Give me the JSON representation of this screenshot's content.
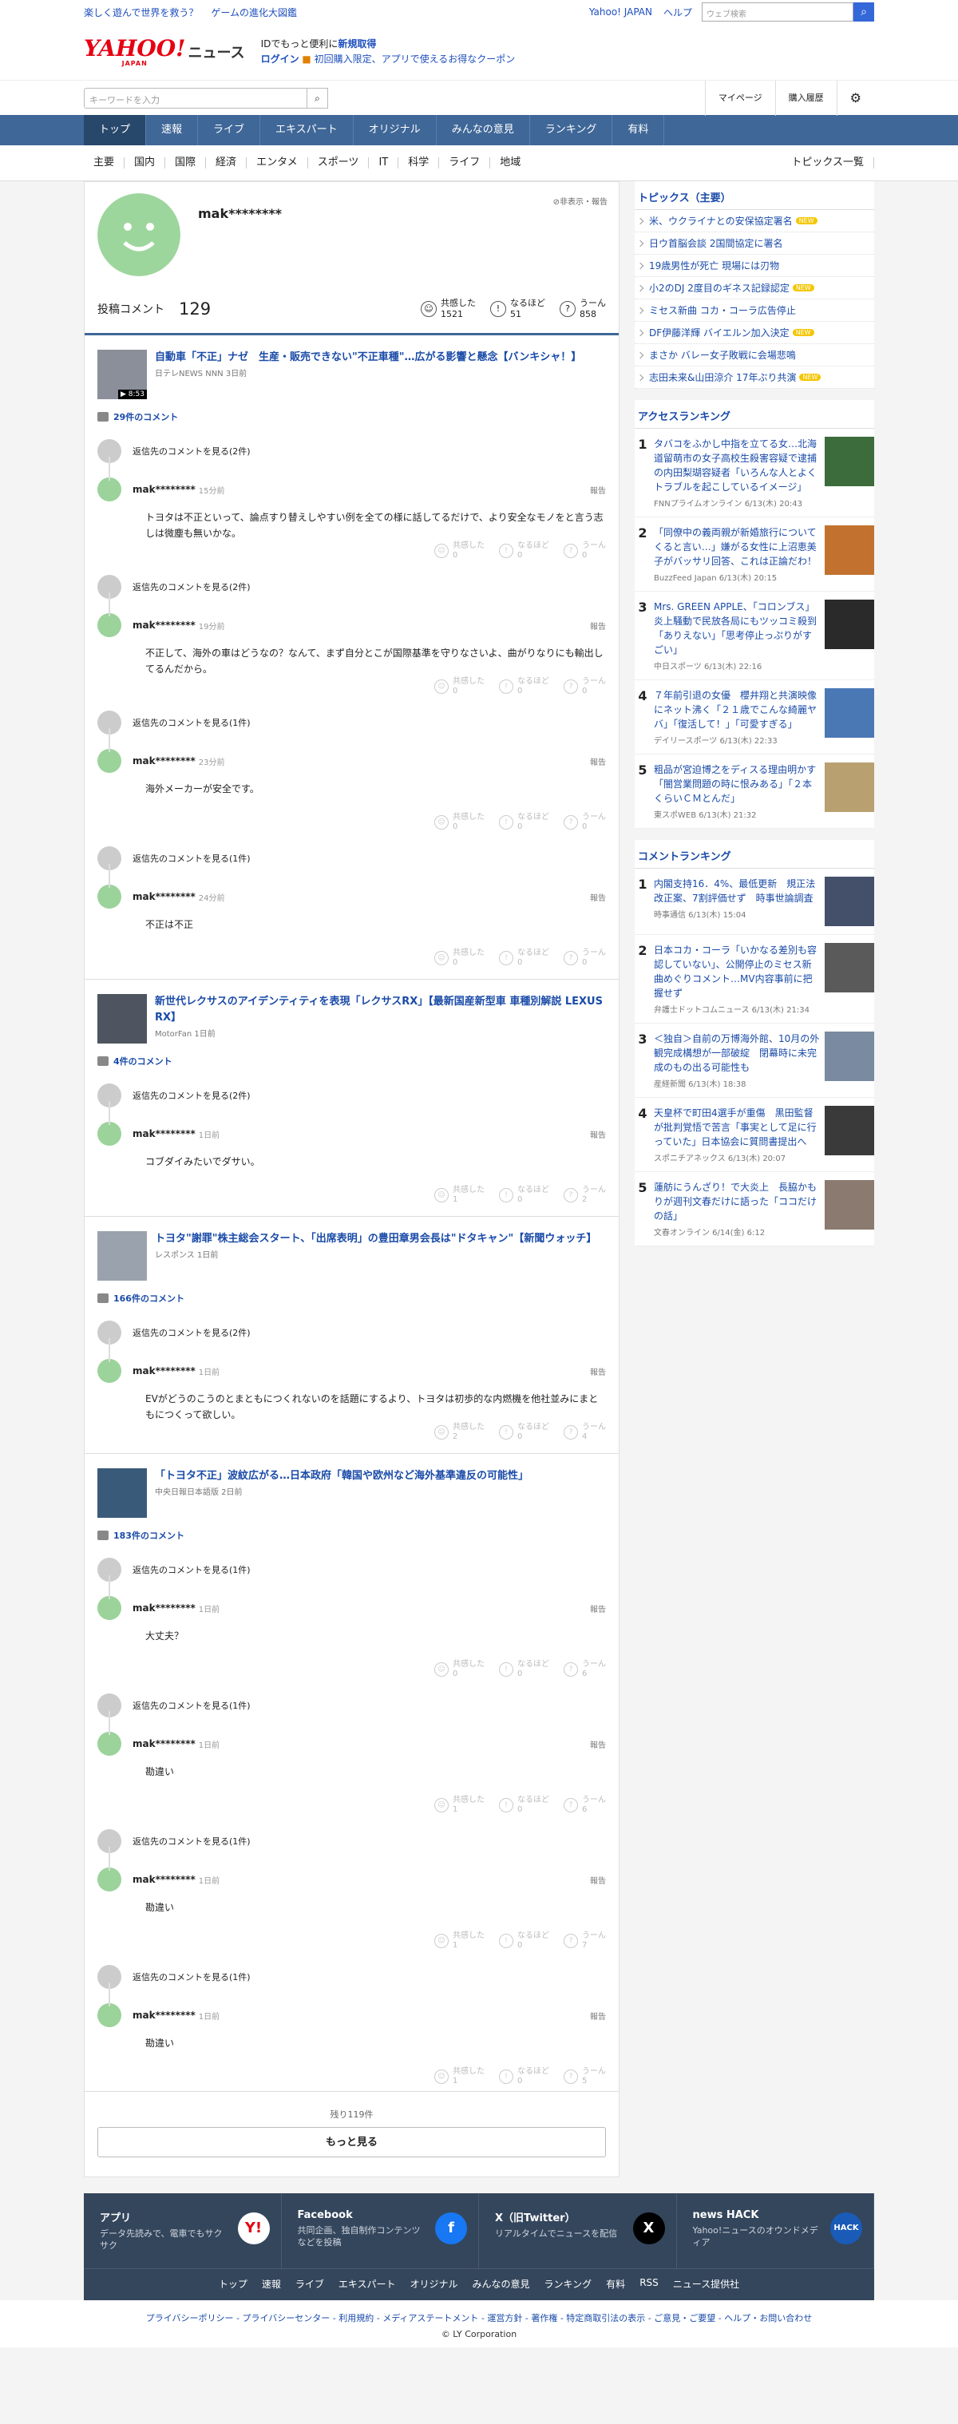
{
  "topbar": {
    "links": [
      "楽しく遊んで世界を救う？",
      "ゲームの進化大図鑑"
    ],
    "yj": "Yahoo! JAPAN",
    "help": "ヘルプ",
    "search_placeholder": "ウェブ検索"
  },
  "header": {
    "logo": "YAHOO!",
    "logo_sub": "JAPAN",
    "news": "ニュース",
    "promo1a": "IDでもっと便利に",
    "promo1b": "新規取得",
    "promo2a": "ログイン",
    "promo2b": "初回購入限定、アプリで使えるお得なクーポン"
  },
  "search": {
    "placeholder": "キーワードを入力",
    "mypage": "マイページ",
    "history": "購入履歴"
  },
  "gnav": [
    "トップ",
    "速報",
    "ライブ",
    "エキスパート",
    "オリジナル",
    "みんなの意見",
    "ランキング",
    "有料"
  ],
  "cnav": [
    "主要",
    "国内",
    "国際",
    "経済",
    "エンタメ",
    "スポーツ",
    "IT",
    "科学",
    "ライフ",
    "地域"
  ],
  "cnav_topics": "トピックス一覧",
  "profile": {
    "name": "mak********",
    "report": "非表示・報告",
    "label": "投稿コメント",
    "count": "129",
    "r1": "共感した",
    "v1": "1521",
    "r2": "なるほど",
    "v2": "51",
    "r3": "うーん",
    "v3": "858"
  },
  "labels": {
    "see_replies": "返信先のコメントを見る",
    "report": "報告",
    "kyokan": "共感した",
    "naruhodo": "なるほど",
    "uun": "うーん"
  },
  "articles": [
    {
      "title": "自動車「不正」ナゼ　生産・販売できない\"不正車種\"…広がる影響と懸念【バンキシャ！】",
      "source": "日テレNEWS NNN",
      "time": "3日前",
      "dur": "8:53",
      "count": "29件のコメント",
      "thumb": "#8a8f99",
      "comments": [
        {
          "replies": "(2件)",
          "user": "mak********",
          "time": "15分前",
          "body": "トヨタは不正といって、論点すり替えしやすい例を全ての様に話してるだけで、より安全なモノをと言う志しは微塵も無いかな。",
          "v": [
            "0",
            "0",
            "0"
          ]
        },
        {
          "replies": "(2件)",
          "user": "mak********",
          "time": "19分前",
          "body": "不正して、海外の車はどうなの？なんて、まず自分とこが国際基準を守りなさいよ、曲がりなりにも輸出してるんだから。",
          "v": [
            "0",
            "0",
            "0"
          ]
        },
        {
          "replies": "(1件)",
          "user": "mak********",
          "time": "23分前",
          "body": "海外メーカーが安全です。",
          "v": [
            "0",
            "0",
            "0"
          ]
        },
        {
          "replies": "(1件)",
          "user": "mak********",
          "time": "24分前",
          "body": "不正は不正",
          "v": [
            "0",
            "0",
            "0"
          ]
        }
      ]
    },
    {
      "title": "新世代レクサスのアイデンティティを表現「レクサスRX」【最新国産新型車 車種別解説 LEXUS RX】",
      "source": "MotorFan",
      "time": "1日前",
      "dur": "",
      "count": "4件のコメント",
      "thumb": "#4e5560",
      "comments": [
        {
          "replies": "(2件)",
          "user": "mak********",
          "time": "1日前",
          "body": "コブダイみたいでダサい。",
          "v": [
            "1",
            "0",
            "2"
          ]
        }
      ]
    },
    {
      "title": "トヨタ\"謝罪\"株主総会スタート、「出席表明」の豊田章男会長は\"ドタキャン\"【新聞ウォッチ】",
      "source": "レスポンス",
      "time": "1日前",
      "dur": "",
      "count": "166件のコメント",
      "thumb": "#9aa3ad",
      "comments": [
        {
          "replies": "(2件)",
          "user": "mak********",
          "time": "1日前",
          "body": "EVがどうのこうのとまともにつくれないのを話題にするより、トヨタは初歩的な内燃機を他社並みにまともにつくって欲しい。",
          "v": [
            "2",
            "0",
            "4"
          ]
        }
      ]
    },
    {
      "title": "「トヨタ不正」波紋広がる…日本政府「韓国や欧州など海外基準違反の可能性」",
      "source": "中央日報日本語版",
      "time": "2日前",
      "dur": "",
      "count": "183件のコメント",
      "thumb": "#3a5a7a",
      "comments": [
        {
          "replies": "(1件)",
          "user": "mak********",
          "time": "1日前",
          "body": "大丈夫？",
          "v": [
            "0",
            "0",
            "6"
          ]
        },
        {
          "replies": "(1件)",
          "user": "mak********",
          "time": "1日前",
          "body": "勘違い",
          "v": [
            "1",
            "0",
            "6"
          ]
        },
        {
          "replies": "(1件)",
          "user": "mak********",
          "time": "1日前",
          "body": "勘違い",
          "v": [
            "1",
            "0",
            "7"
          ]
        },
        {
          "replies": "(1件)",
          "user": "mak********",
          "time": "1日前",
          "body": "勘違い",
          "v": [
            "1",
            "0",
            "5"
          ]
        }
      ]
    }
  ],
  "more": {
    "remaining": "残り119件",
    "button": "もっと見る"
  },
  "topics": {
    "title": "トピックス（主要）",
    "items": [
      {
        "t": "米、ウクライナとの安保協定署名",
        "new": true
      },
      {
        "t": "日ウ首脳会談 2国間協定に署名",
        "new": false
      },
      {
        "t": "19歳男性が死亡 現場には刃物",
        "new": false
      },
      {
        "t": "小2のDJ 2度目のギネス記録認定",
        "new": true
      },
      {
        "t": "ミセス新曲 コカ・コーラ広告停止",
        "new": false
      },
      {
        "t": "DF伊藤洋輝 バイエルン加入決定",
        "new": true
      },
      {
        "t": "まさか バレー女子敗戦に会場悲鳴",
        "new": false
      },
      {
        "t": "志田未来&山田涼介 17年ぶり共演",
        "new": true
      }
    ],
    "new_label": "NEW"
  },
  "access": {
    "title": "アクセスランキング",
    "items": [
      {
        "n": "1",
        "t": "タバコをふかし中指を立てる女…北海道留萌市の女子高校生殺害容疑で逮捕の内田梨瑚容疑者「いろんな人とよくトラブルを起こしているイメージ」",
        "s": "FNNプライムオンライン 6/13(木) 20:43",
        "c": "#3c6b3c"
      },
      {
        "n": "2",
        "t": "「同僚中の義両親が新婚旅行についてくると言い…」嫌がる女性に上沼恵美子がバッサリ回答、これは正論だわ！",
        "s": "BuzzFeed Japan 6/13(木) 20:15",
        "c": "#c2722e"
      },
      {
        "n": "3",
        "t": "Mrs. GREEN APPLE、「コロンブス」炎上騒動で民放各局にもツッコミ殺到「ありえない」「思考停止っぷりがすごい」",
        "s": "中日スポーツ 6/13(木) 22:16",
        "c": "#2a2a2a"
      },
      {
        "n": "4",
        "t": "７年前引退の女優　櫻井翔と共演映像にネット沸く「２１歳でこんな綺麗ヤバ」「復活して！」「可愛すぎる」",
        "s": "デイリースポーツ 6/13(木) 22:33",
        "c": "#4a78b5"
      },
      {
        "n": "5",
        "t": "粗品が宮迫博之をディスる理由明かす「闇営業問題の時に恨みある」「２本くらいＣＭとんだ」",
        "s": "東スポWEB 6/13(木) 21:32",
        "c": "#b8a070"
      }
    ]
  },
  "cranking": {
    "title": "コメントランキング",
    "items": [
      {
        "n": "1",
        "t": "内閣支持16．4%、最低更新　規正法改正案、7割評価せず　時事世論調査",
        "s": "時事通信 6/13(木) 15:04",
        "c": "#44506a"
      },
      {
        "n": "2",
        "t": "日本コカ・コーラ「いかなる差別も容認していない」、公開停止のミセス新曲めぐりコメント…MV内容事前に把握せず",
        "s": "弁護士ドットコムニュース 6/13(木) 21:34",
        "c": "#5a5a5a"
      },
      {
        "n": "3",
        "t": "＜独自＞自前の万博海外館、10月の外観完成構想が一部破綻　閉幕時に未完成のもの出る可能性も",
        "s": "産経新聞 6/13(木) 18:38",
        "c": "#7a8aa0"
      },
      {
        "n": "4",
        "t": "天皇杯で町田4選手が重傷　黒田監督が批判覚悟で苦言「事実として足に行っていた」日本協会に質問書提出へ",
        "s": "スポニチアネックス 6/13(木) 20:07",
        "c": "#3a3a3a"
      },
      {
        "n": "5",
        "t": "蓮舫にうんざり！で大炎上　長脇かもりが週刊文春だけに語った「ココだけの話」",
        "s": "文春オンライン 6/14(金) 6:12",
        "c": "#8a7a70"
      }
    ]
  },
  "footer": {
    "apps": [
      {
        "t": "アプリ",
        "d": "データ先読みで、電車でもサクサク",
        "lg": "Y!",
        "col": "#ffffff",
        "fg": "#e60012"
      },
      {
        "t": "Facebook",
        "d": "共同企画、独自制作コンテンツなどを投稿",
        "lg": "f",
        "col": "#1877f2",
        "fg": "#ffffff"
      },
      {
        "t": "X（旧Twitter）",
        "d": "リアルタイムでニュースを配信",
        "lg": "X",
        "col": "#000000",
        "fg": "#ffffff"
      },
      {
        "t": "news HACK",
        "d": "Yahoo!ニュースのオウンドメディア",
        "lg": "HACK",
        "col": "#1a5bb8",
        "fg": "#ffffff"
      }
    ],
    "links": [
      "トップ",
      "速報",
      "ライブ",
      "エキスパート",
      "オリジナル",
      "みんなの意見",
      "ランキング",
      "有料",
      "RSS",
      "ニュース提供社"
    ],
    "legal": "プライバシーポリシー - プライバシーセンター - 利用規約 - メディアステートメント - 運営方針 - 著作権 - 特定商取引法の表示 - ご意見・ご要望 - ヘルプ・お問い合わせ",
    "copyright": "© LY Corporation"
  }
}
